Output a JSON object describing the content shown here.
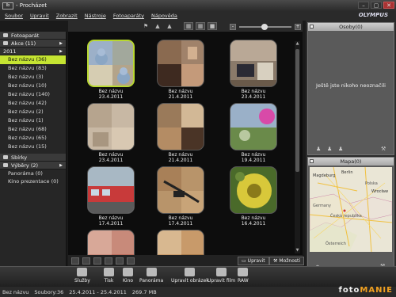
{
  "window": {
    "app_icon": "Ib",
    "title": "- Procházet",
    "brand": "OLYMPUS",
    "min": "–",
    "max": "▢",
    "close": "✕"
  },
  "menu": [
    "Soubor",
    "Upravit",
    "Zobrazit",
    "Nástroje",
    "Fotoaparáty",
    "Nápověda"
  ],
  "sidebar": {
    "fotoaparat": "Fotoaparát",
    "akce": "Akce (11)",
    "year": "2011",
    "events": [
      "Bez názvu (36)",
      "Bez názvu (83)",
      "Bez názvu (3)",
      "Bez názvu (10)",
      "Bez názvu (140)",
      "Bez názvu (42)",
      "Bez názvu (2)",
      "Bez názvu (1)",
      "Bez názvu (68)",
      "Bez názvu (65)",
      "Bez názvu (15)"
    ],
    "sbirky": "Sbírky",
    "vybery": "Výběry (2)",
    "panorama": "Panoráma (0)",
    "kino": "Kino prezentace (0)"
  },
  "thumbs": [
    {
      "name": "Bez názvu",
      "date": "23.4.2011"
    },
    {
      "name": "Bez názvu",
      "date": "21.4.2011"
    },
    {
      "name": "Bez názvu",
      "date": "23.4.2011"
    },
    {
      "name": "Bez názvu",
      "date": "23.4.2011"
    },
    {
      "name": "Bez názvu",
      "date": "21.4.2011"
    },
    {
      "name": "Bez názvu",
      "date": "19.4.2011"
    },
    {
      "name": "Bez názvu",
      "date": "17.4.2011"
    },
    {
      "name": "Bez názvu",
      "date": "17.4.2011"
    },
    {
      "name": "Bez názvu",
      "date": "16.4.2011"
    },
    {
      "name": "",
      "date": ""
    },
    {
      "name": "",
      "date": ""
    },
    {
      "name": "",
      "date": ""
    }
  ],
  "grid_buttons": {
    "upravit": "Upravit",
    "moznosti": "Možnosti"
  },
  "persons": {
    "title": "Osoby(0)",
    "message": "Ještě jste nikoho neoznačili"
  },
  "mapa": {
    "title": "Mapa(0)",
    "labels": {
      "berlin": "Berlin",
      "magdeburg": "Magdeburg",
      "germany": "Germany",
      "poland": "Polska",
      "czech": "Česká republika",
      "austria": "Österreich",
      "wroclaw": "Wrocław"
    }
  },
  "bottom_buttons": [
    "Služby",
    "Tisk",
    "Kino",
    "Panoráma",
    "Upravit obrázek",
    "Upravit film",
    "RAW"
  ],
  "status": {
    "name": "Bez názvu",
    "count": "Soubory:36",
    "range": "25.4.2011 - 25.4.2011",
    "size": "269.7 MB"
  },
  "watermark": {
    "a": "foto",
    "b": "MANIE"
  }
}
